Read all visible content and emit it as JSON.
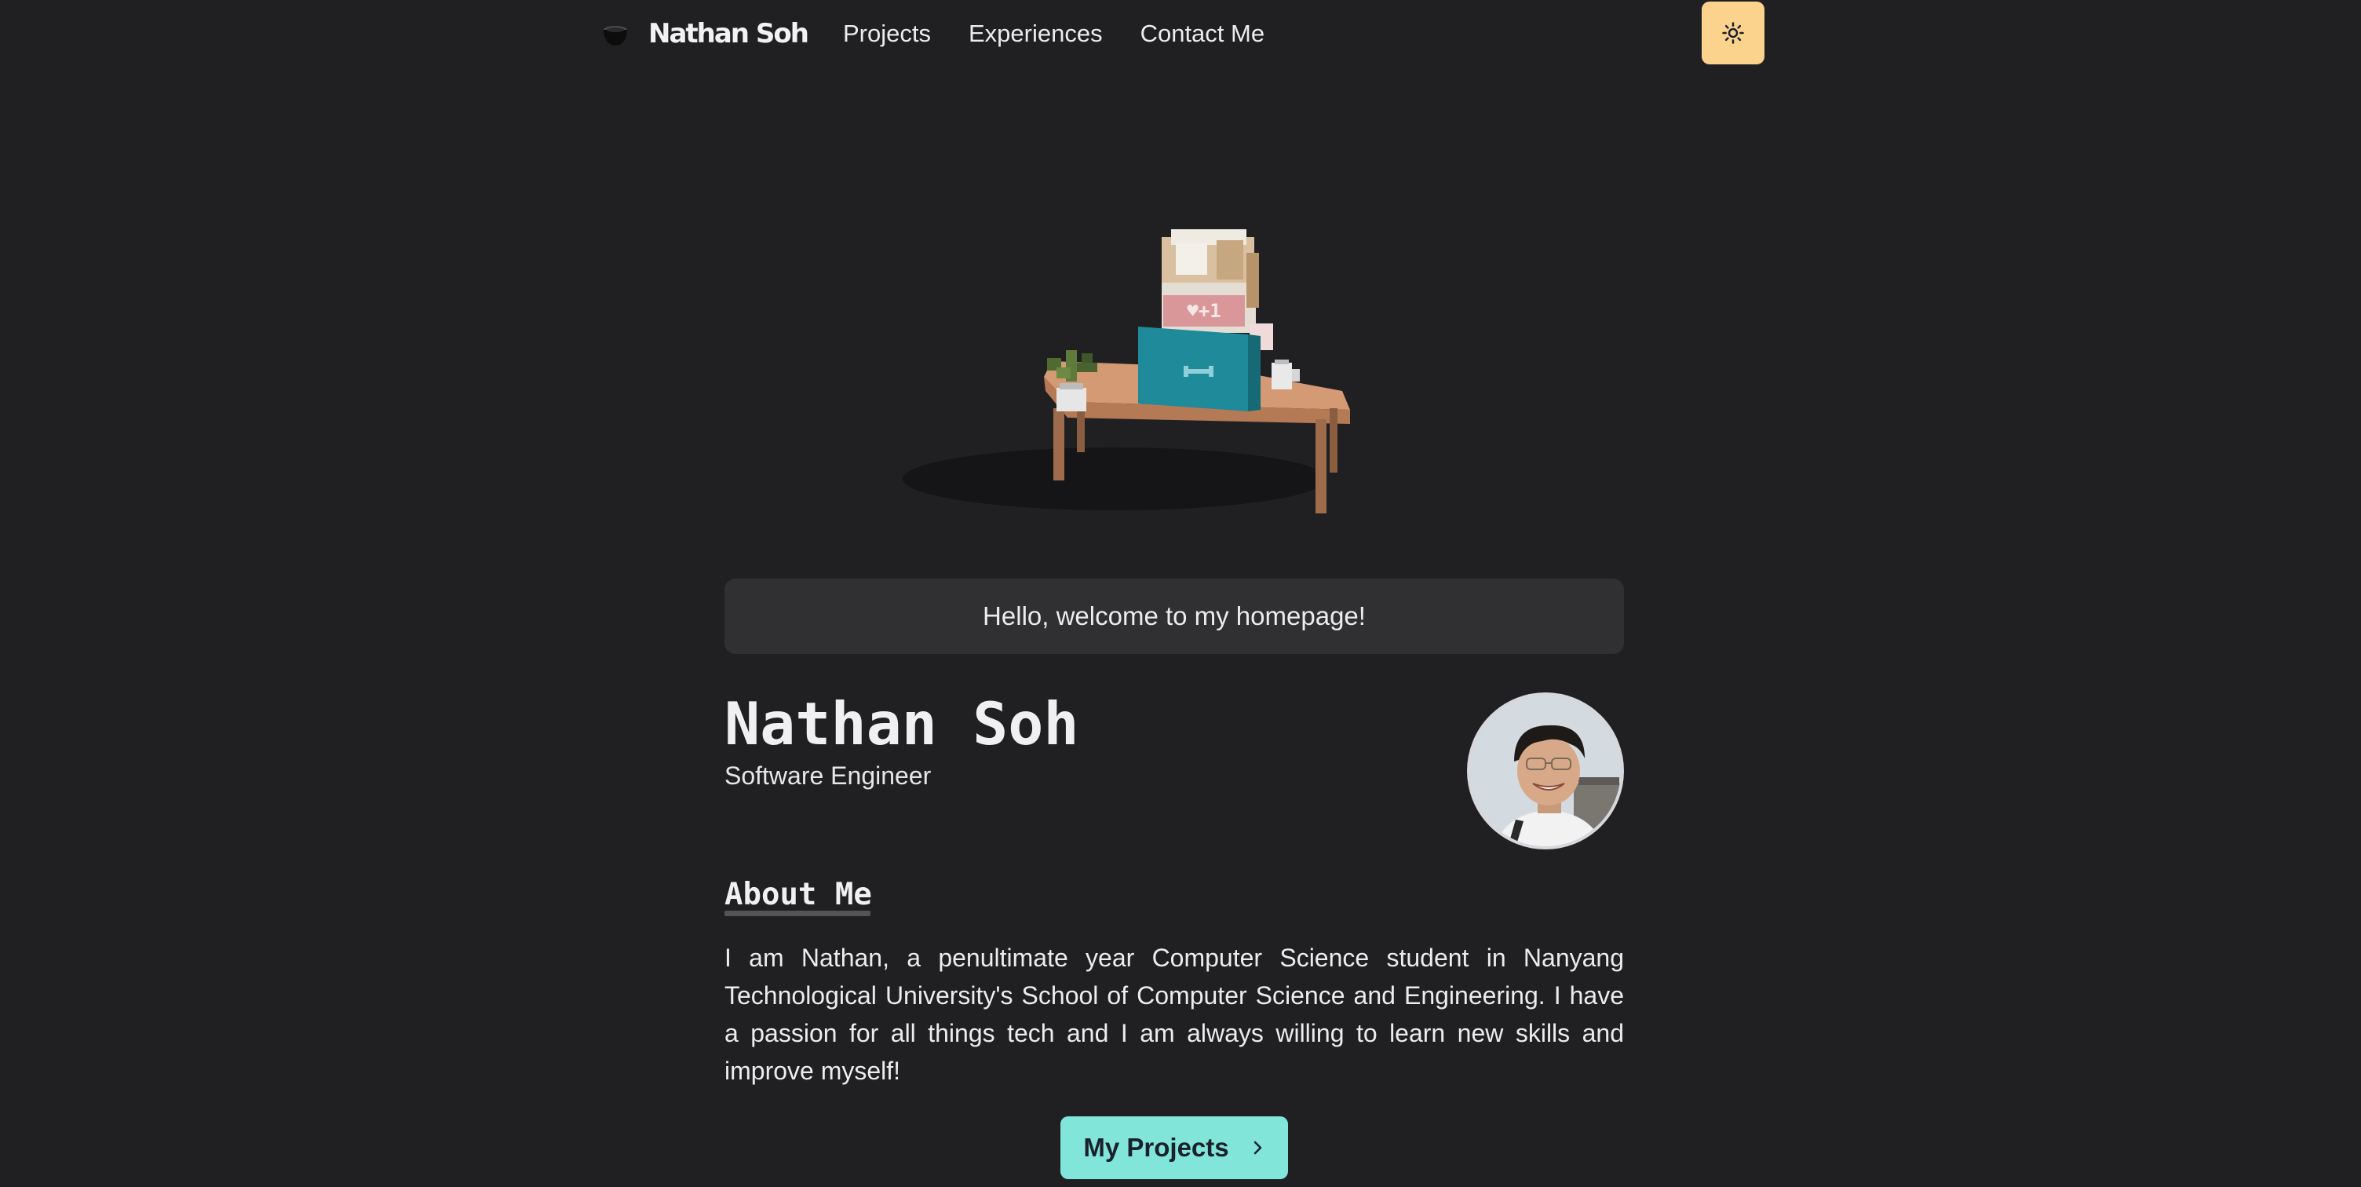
{
  "navbar": {
    "brand_name": "Nathan Soh",
    "links": [
      "Projects",
      "Experiences",
      "Contact Me"
    ],
    "theme_toggle_icon": "sun-icon"
  },
  "hero": {
    "scene_icon": "voxel-desk-scene"
  },
  "main": {
    "greeting": "Hello, welcome to my homepage!",
    "name": "Nathan Soh",
    "role": "Software Engineer",
    "about_heading": "About Me",
    "about_text": "I am Nathan, a penultimate year Computer Science student in Nanyang Technological University's School of Computer Science and Engineering. I have a passion for all things tech and I am always willing to learn new skills and improve myself!",
    "cta_label": "My Projects",
    "cta_icon": "chevron-right-icon"
  },
  "colors": {
    "background": "#202023",
    "card": "#303033",
    "accent_teal": "#81e6d9",
    "toggle_yellow": "#fbd38d"
  }
}
